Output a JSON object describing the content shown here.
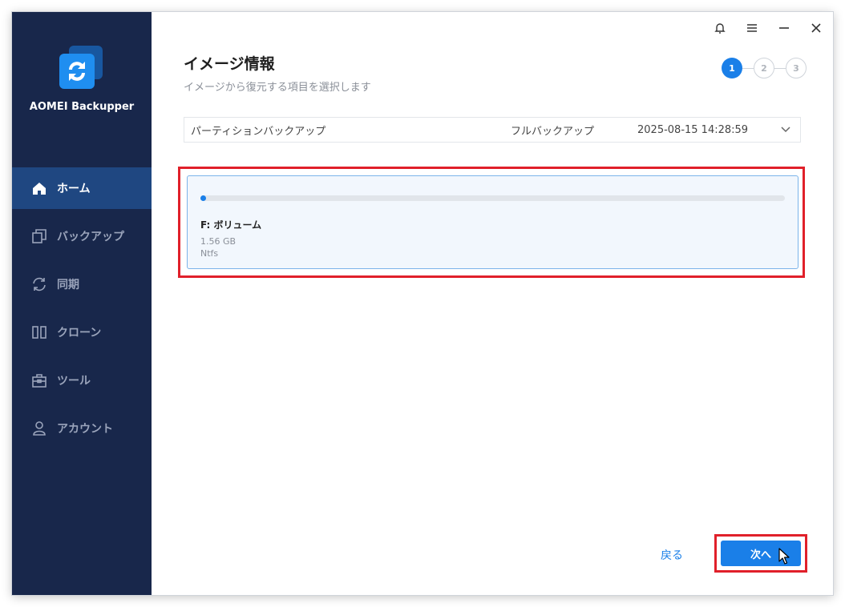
{
  "app": {
    "name": "AOMEI Backupper"
  },
  "sidebar": {
    "items": [
      {
        "label": "ホーム",
        "icon": "home-icon",
        "active": true
      },
      {
        "label": "バックアップ",
        "icon": "backup-icon",
        "active": false
      },
      {
        "label": "同期",
        "icon": "sync-icon",
        "active": false
      },
      {
        "label": "クローン",
        "icon": "clone-icon",
        "active": false
      },
      {
        "label": "ツール",
        "icon": "toolbox-icon",
        "active": false
      },
      {
        "label": "アカウント",
        "icon": "user-icon",
        "active": false
      }
    ]
  },
  "titlebar": {
    "icons": [
      "bell-icon",
      "menu-icon",
      "minimize-icon",
      "close-icon"
    ]
  },
  "page": {
    "title": "イメージ情報",
    "subtitle": "イメージから復元する項目を選択します"
  },
  "steps": {
    "items": [
      "1",
      "2",
      "3"
    ],
    "current": 1
  },
  "backup": {
    "name": "パーティションバックアップ",
    "type": "フルバックアップ",
    "date": "2025-08-15 14:28:59"
  },
  "partition": {
    "label": "F: ボリューム",
    "size": "1.56 GB",
    "filesystem": "Ntfs",
    "usage_fraction": 0.01
  },
  "footer": {
    "back_label": "戻る",
    "next_label": "次へ"
  },
  "colors": {
    "sidebar_bg": "#18274b",
    "sidebar_active": "#1f4781",
    "accent": "#1a7fe8",
    "highlight": "#e0202a"
  }
}
